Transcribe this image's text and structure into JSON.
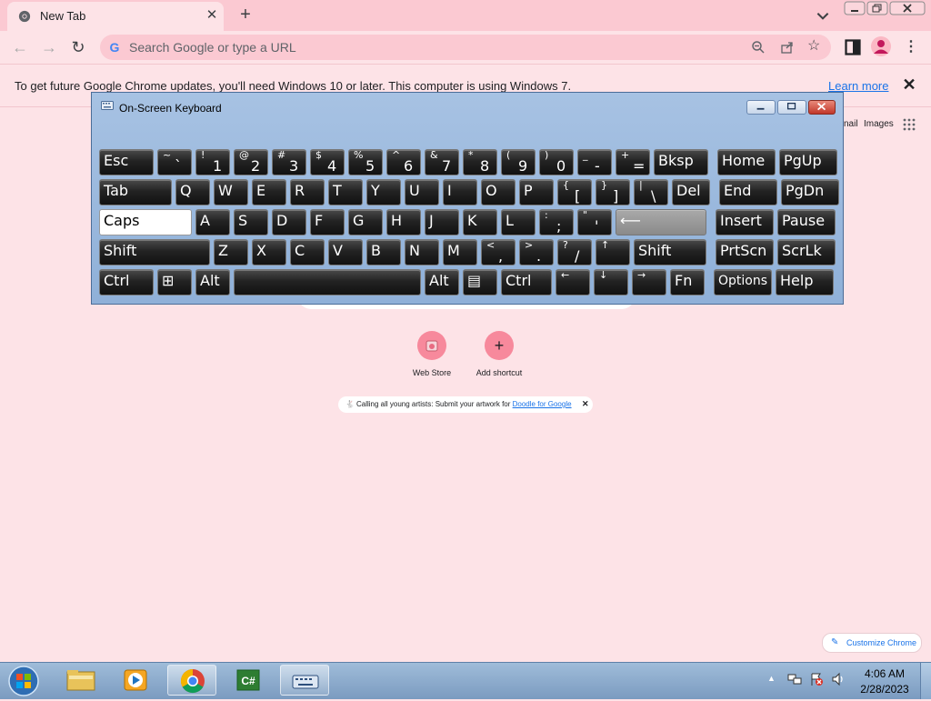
{
  "browser": {
    "tab_title": "New Tab",
    "tab_close": "✕",
    "new_tab": "+",
    "omnibox_placeholder": "Search Google or type a URL",
    "star": "☆",
    "menu": "⋮"
  },
  "infobar": {
    "text": "To get future Google Chrome updates, you'll need Windows 10 or later. This computer is using Windows 7.",
    "link": "Learn more",
    "close": "✕"
  },
  "ntp": {
    "gmail": "nail",
    "images": "Images",
    "shortcuts": [
      {
        "label": "Web Store"
      },
      {
        "label": "Add shortcut",
        "icon": "+"
      }
    ],
    "promo_text": "Calling all young artists: Submit your artwork for ",
    "promo_link": "Doodle for Google",
    "promo_close": "✕",
    "customize": "Customize Chrome"
  },
  "osk": {
    "title": "On-Screen Keyboard",
    "rows": [
      [
        {
          "label": "Esc"
        },
        {
          "shift": "~",
          "main": "`"
        },
        {
          "shift": "!",
          "main": "1"
        },
        {
          "shift": "@",
          "main": "2"
        },
        {
          "shift": "#",
          "main": "3"
        },
        {
          "shift": "$",
          "main": "4"
        },
        {
          "shift": "%",
          "main": "5"
        },
        {
          "shift": "^",
          "main": "6"
        },
        {
          "shift": "&",
          "main": "7"
        },
        {
          "shift": "*",
          "main": "8"
        },
        {
          "shift": "(",
          "main": "9"
        },
        {
          "shift": ")",
          "main": "0"
        },
        {
          "shift": "_",
          "main": "-"
        },
        {
          "shift": "+",
          "main": "="
        },
        {
          "label": "Bksp"
        },
        {
          "label": "Home"
        },
        {
          "label": "PgUp"
        }
      ],
      [
        {
          "label": "Tab"
        },
        {
          "label": "Q"
        },
        {
          "label": "W"
        },
        {
          "label": "E"
        },
        {
          "label": "R"
        },
        {
          "label": "T"
        },
        {
          "label": "Y"
        },
        {
          "label": "U"
        },
        {
          "label": "I"
        },
        {
          "label": "O"
        },
        {
          "label": "P"
        },
        {
          "shift": "{",
          "main": "["
        },
        {
          "shift": "}",
          "main": "]"
        },
        {
          "shift": "|",
          "main": "\\"
        },
        {
          "label": "Del"
        },
        {
          "label": "End"
        },
        {
          "label": "PgDn"
        }
      ],
      [
        {
          "label": "Caps"
        },
        {
          "label": "A"
        },
        {
          "label": "S"
        },
        {
          "label": "D"
        },
        {
          "label": "F"
        },
        {
          "label": "G"
        },
        {
          "label": "H"
        },
        {
          "label": "J"
        },
        {
          "label": "K"
        },
        {
          "label": "L"
        },
        {
          "shift": ":",
          "main": ";"
        },
        {
          "shift": "\"",
          "main": "'"
        },
        {
          "label": "⟵"
        },
        {
          "label": "Insert"
        },
        {
          "label": "Pause"
        }
      ],
      [
        {
          "label": "Shift"
        },
        {
          "label": "Z"
        },
        {
          "label": "X"
        },
        {
          "label": "C"
        },
        {
          "label": "V"
        },
        {
          "label": "B"
        },
        {
          "label": "N"
        },
        {
          "label": "M"
        },
        {
          "shift": "<",
          "main": ","
        },
        {
          "shift": ">",
          "main": "."
        },
        {
          "shift": "?",
          "main": "/"
        },
        {
          "shift": "↑",
          "main": ""
        },
        {
          "label": "Shift"
        },
        {
          "label": "PrtScn"
        },
        {
          "label": "ScrLk"
        }
      ],
      [
        {
          "label": "Ctrl"
        },
        {
          "label": "⊞"
        },
        {
          "label": "Alt"
        },
        {
          "label": ""
        },
        {
          "label": "Alt"
        },
        {
          "label": "▤"
        },
        {
          "label": "Ctrl"
        },
        {
          "shift": "←",
          "main": ""
        },
        {
          "shift": "↓",
          "main": ""
        },
        {
          "shift": "→",
          "main": ""
        },
        {
          "label": "Fn"
        },
        {
          "label": "Options"
        },
        {
          "label": "Help"
        }
      ]
    ]
  },
  "taskbar": {
    "time": "4:06 AM",
    "date": "2/28/2023",
    "apps": [
      "explorer",
      "media-player",
      "chrome",
      "csharp",
      "on-screen-keyboard"
    ]
  },
  "colors": {
    "page_bg": "#fde3e7",
    "tabstrip": "#fbc9d2",
    "accent_link": "#1a73e8",
    "shortcut_circle": "#f7899c"
  }
}
